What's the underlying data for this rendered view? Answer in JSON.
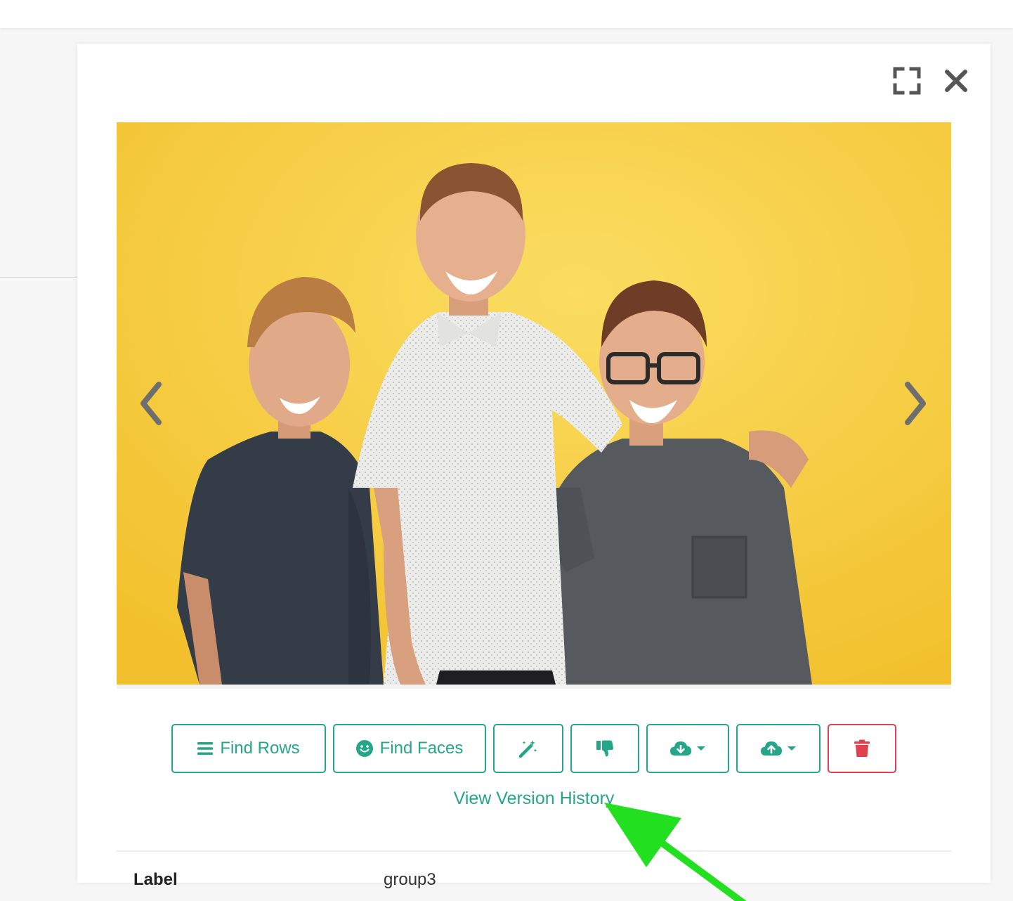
{
  "viewer": {
    "expand_icon": "expand-icon",
    "close_icon": "close-icon",
    "prev_icon": "chevron-left-icon",
    "next_icon": "chevron-right-icon"
  },
  "photo": {
    "background_color": "#f6cc3c"
  },
  "actions": {
    "find_rows_label": "Find Rows",
    "find_rows_icon": "list-icon",
    "find_faces_label": "Find Faces",
    "find_faces_icon": "smile-icon",
    "magic_icon": "magic-wand-icon",
    "thumbs_icon": "thumbs-down-icon",
    "download_icon": "cloud-download-icon",
    "upload_icon": "cloud-upload-icon",
    "delete_icon": "trash-icon",
    "accent_color": "#25a688",
    "danger_color": "#e0414f"
  },
  "version_history_label": "View Version History",
  "properties": [
    {
      "key": "Label",
      "value": "group3"
    }
  ],
  "annotation": {
    "arrow_color": "#22e01f"
  }
}
